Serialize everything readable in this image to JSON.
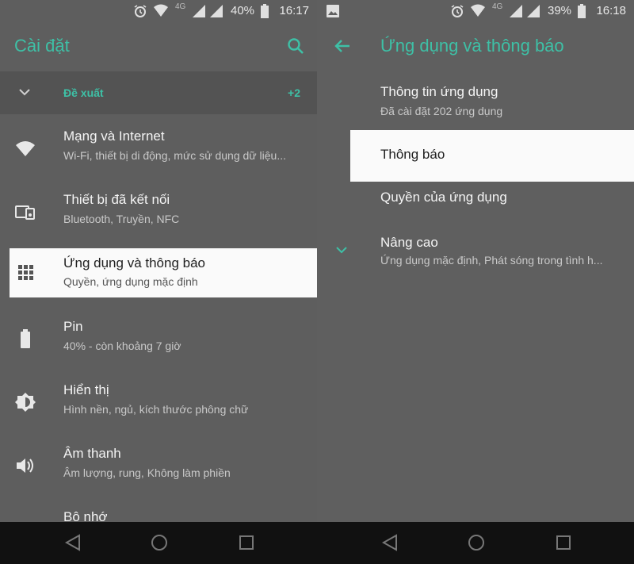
{
  "colors": {
    "accent": "#3ec0a6",
    "background": "#5e5e5e",
    "highlight": "#fafafa",
    "navbar": "#111111"
  },
  "left": {
    "status": {
      "battery_pct": "40%",
      "time": "16:17",
      "network": "4G"
    },
    "appbar": {
      "title": "Cài đặt"
    },
    "suggestions": {
      "label": "Đề xuất",
      "count": "+2"
    },
    "items": [
      {
        "title": "Mạng và Internet",
        "subtitle": "Wi-Fi, thiết bị di động, mức sử dụng dữ liệu...",
        "icon": "wifi-icon"
      },
      {
        "title": "Thiết bị đã kết nối",
        "subtitle": "Bluetooth, Truyền, NFC",
        "icon": "devices-icon"
      },
      {
        "title": "Ứng dụng và thông báo",
        "subtitle": "Quyền, ứng dụng mặc định",
        "icon": "apps-grid-icon"
      },
      {
        "title": "Pin",
        "subtitle": "40% - còn khoảng 7 giờ",
        "icon": "battery-icon"
      },
      {
        "title": "Hiển thị",
        "subtitle": "Hình nền, ngủ, kích thước phông chữ",
        "icon": "brightness-icon"
      },
      {
        "title": "Âm thanh",
        "subtitle": "Âm lượng, rung, Không làm phiền",
        "icon": "volume-icon"
      },
      {
        "title": "Bộ nhớ",
        "subtitle": "",
        "icon": "storage-icon"
      }
    ]
  },
  "right": {
    "status": {
      "battery_pct": "39%",
      "time": "16:18",
      "network": "4G"
    },
    "appbar": {
      "title": "Ứng dụng và thông báo"
    },
    "items": [
      {
        "title": "Thông tin ứng dụng",
        "subtitle": "Đã cài đặt 202 ứng dụng"
      },
      {
        "title": "Thông báo",
        "subtitle": ""
      },
      {
        "title": "Quyền của ứng dụng",
        "subtitle": ""
      },
      {
        "title": "Nâng cao",
        "subtitle": "Ứng dụng mặc định, Phát sóng trong tình h..."
      }
    ]
  },
  "navbar": {
    "buttons": [
      "back-nav",
      "home-nav",
      "recents-nav"
    ]
  }
}
